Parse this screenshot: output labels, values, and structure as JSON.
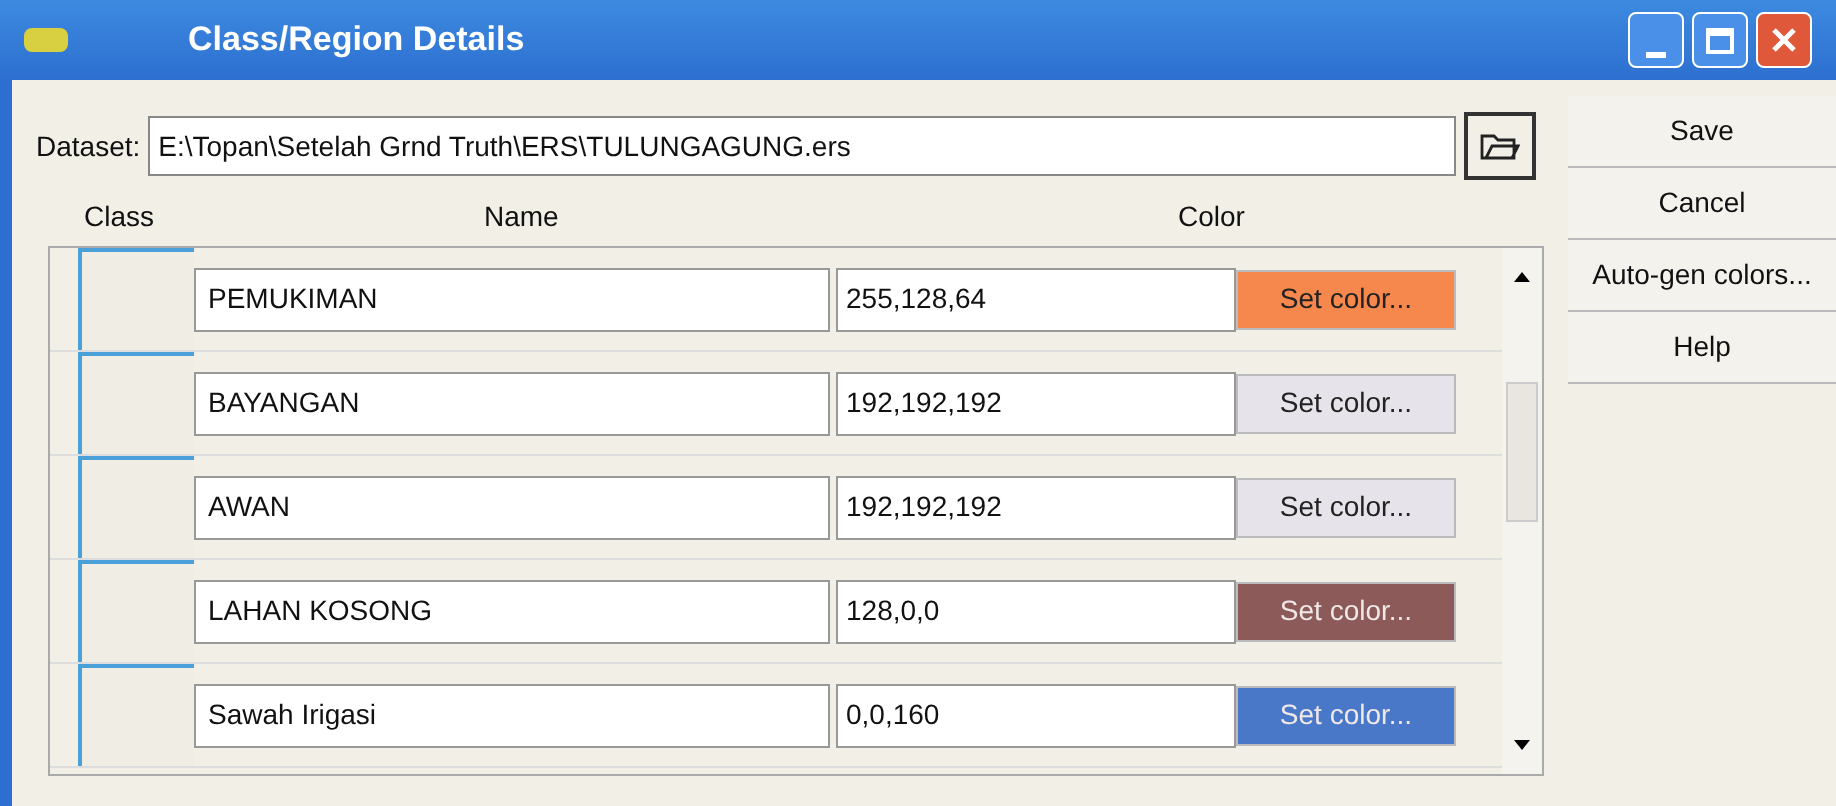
{
  "window": {
    "title": "Class/Region Details"
  },
  "dataset": {
    "label": "Dataset:",
    "value": "E:\\Topan\\Setelah Grnd Truth\\ERS\\TULUNGAGUNG.ers"
  },
  "table": {
    "columns": [
      "Class",
      "Name",
      "Color"
    ],
    "rows": [
      {
        "name": "PEMUKIMAN",
        "rgb": "255,128,64",
        "button": "Set color...",
        "color": "#f6884e"
      },
      {
        "name": "BAYANGAN",
        "rgb": "192,192,192",
        "button": "Set color...",
        "color": "#e6e4ea"
      },
      {
        "name": "AWAN",
        "rgb": "192,192,192",
        "button": "Set color...",
        "color": "#e6e4ea"
      },
      {
        "name": "LAHAN KOSONG",
        "rgb": "128,0,0",
        "button": "Set color...",
        "color": "#8c5a58"
      },
      {
        "name": "Sawah Irigasi",
        "rgb": "0,0,160",
        "button": "Set color...",
        "color": "#4a78c8"
      }
    ]
  },
  "buttons": [
    "Save",
    "Cancel",
    "Auto-gen colors...",
    "Help"
  ]
}
